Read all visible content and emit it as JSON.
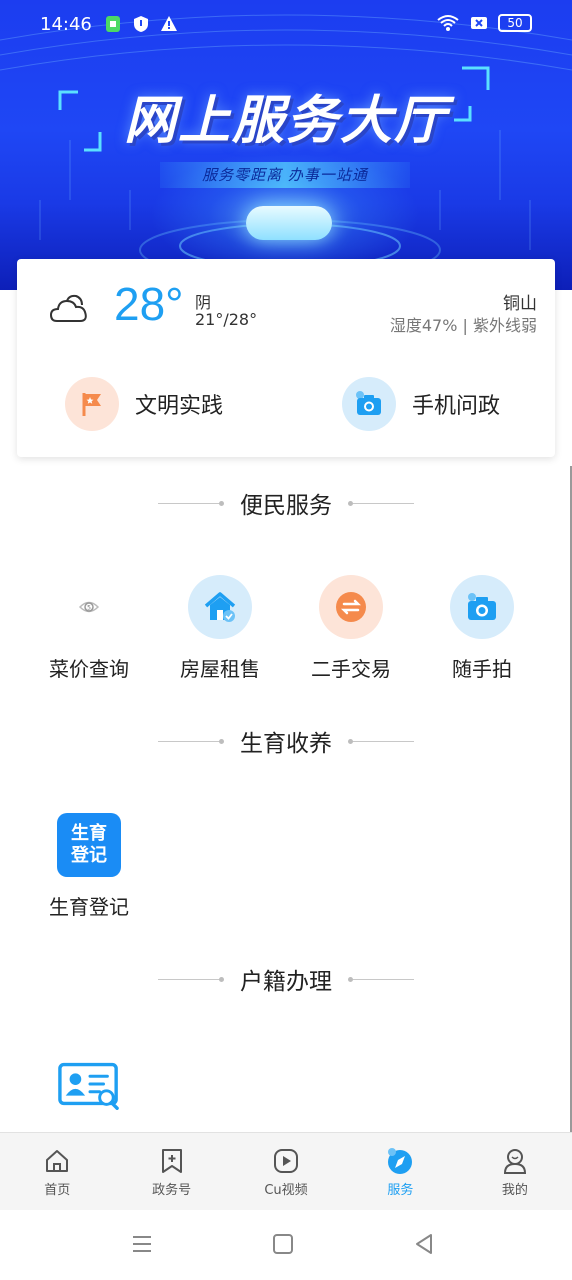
{
  "status_bar": {
    "time": "14:46",
    "battery": "50"
  },
  "banner": {
    "title": "网上服务大厅",
    "subtitle": "服务零距离 办事一站通"
  },
  "weather": {
    "temperature": "28°",
    "condition": "阴",
    "range": "21°/28°",
    "city": "铜山",
    "humidity_uv": "湿度47% | 紫外线弱",
    "icon": "cloud-icon"
  },
  "quick_links": [
    {
      "label": "文明实践",
      "icon": "flag-icon",
      "color": "#f58a4c"
    },
    {
      "label": "手机问政",
      "icon": "camera-icon",
      "color": "#1e9ff2"
    }
  ],
  "sections": {
    "convenience": {
      "title": "便民服务",
      "items": [
        {
          "label": "菜价查询",
          "icon": "price-icon"
        },
        {
          "label": "房屋租售",
          "icon": "house-icon"
        },
        {
          "label": "二手交易",
          "icon": "exchange-icon"
        },
        {
          "label": "随手拍",
          "icon": "camera-icon"
        }
      ]
    },
    "birth": {
      "title": "生育收养",
      "items": [
        {
          "label": "生育登记",
          "tile_line1": "生育",
          "tile_line2": "登记",
          "icon": "birth-register-icon"
        }
      ]
    },
    "household": {
      "title": "户籍办理",
      "items": [
        {
          "icon": "id-card-search-icon"
        }
      ]
    }
  },
  "tabbar": [
    {
      "label": "首页",
      "icon": "home-icon"
    },
    {
      "label": "政务号",
      "icon": "bookmark-plus-icon"
    },
    {
      "label": "Cu视频",
      "icon": "play-icon"
    },
    {
      "label": "服务",
      "icon": "compass-icon",
      "active": true
    },
    {
      "label": "我的",
      "icon": "user-icon"
    }
  ],
  "colors": {
    "accent": "#1e9ff2",
    "banner": "#1f47f5",
    "orange": "#f58a4c"
  }
}
